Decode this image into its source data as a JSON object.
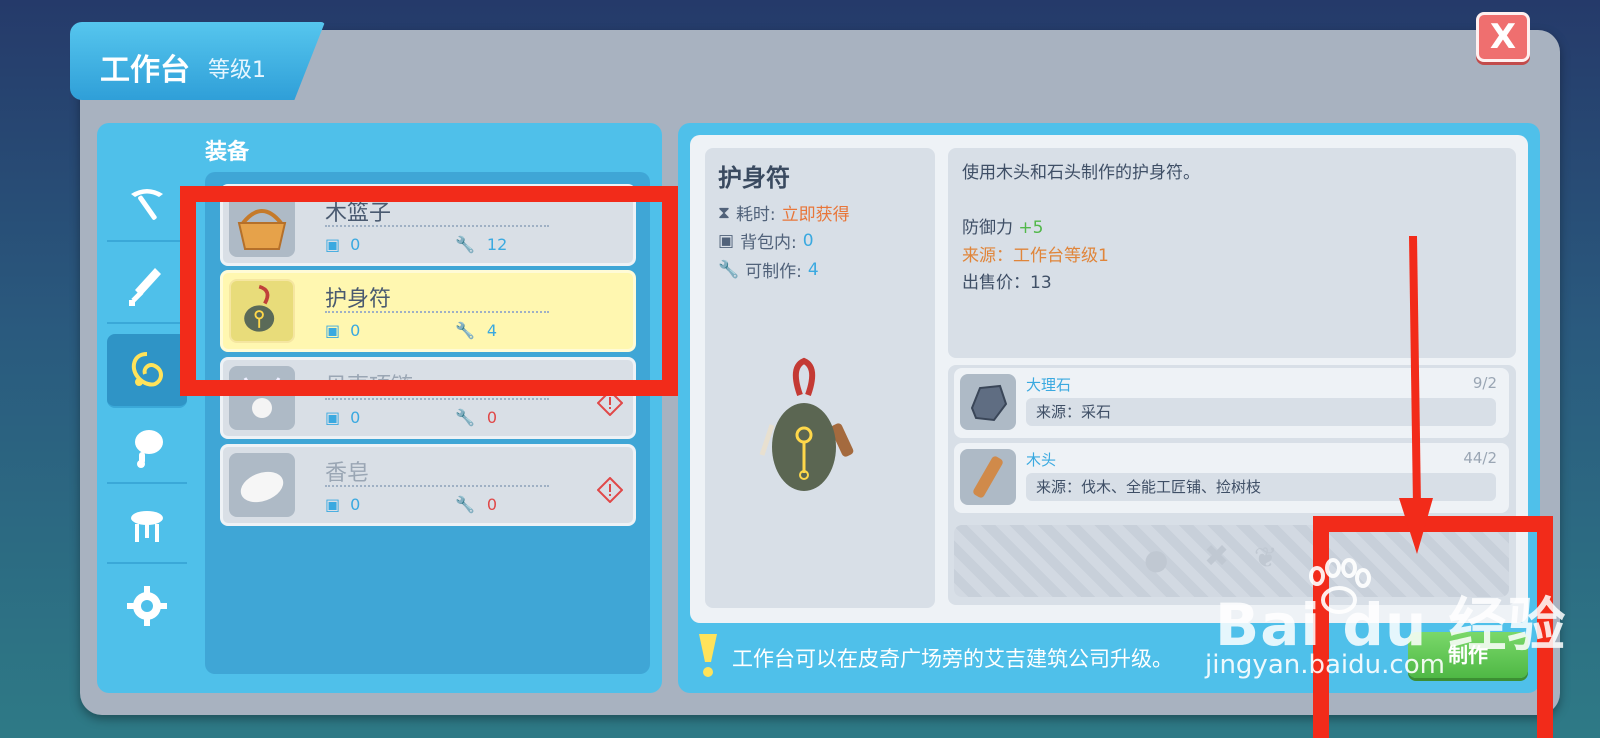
{
  "window": {
    "title": "工作台",
    "level": "等级1",
    "close_label": "X"
  },
  "category": {
    "title": "装备"
  },
  "sidebar": {
    "items": [
      {
        "icon": "pickaxe-icon"
      },
      {
        "icon": "sword-icon"
      },
      {
        "icon": "amulet-icon",
        "active": true
      },
      {
        "icon": "food-icon"
      },
      {
        "icon": "furniture-icon"
      },
      {
        "icon": "gear-icon"
      }
    ]
  },
  "recipes": [
    {
      "name": "木篮子",
      "bag": "0",
      "craftable": "12"
    },
    {
      "name": "护身符",
      "bag": "0",
      "craftable": "4"
    },
    {
      "name": "贝壳项链",
      "bag": "0",
      "craftable": "0"
    },
    {
      "name": "香皂",
      "bag": "0",
      "craftable": "0"
    }
  ],
  "detail": {
    "name": "护身符",
    "time_label": "耗时:",
    "time_value": "立即获得",
    "bag_label": "背包内:",
    "bag_value": "0",
    "craft_label": "可制作:",
    "craft_value": "4",
    "description": "使用木头和石头制作的护身符。",
    "defense_label": "防御力",
    "defense_value": "+5",
    "source_line": "来源：工作台等级1",
    "price_line": "出售价：13"
  },
  "materials": [
    {
      "name": "大理石",
      "count": "9/2",
      "source": "来源：采石"
    },
    {
      "name": "木头",
      "count": "44/2",
      "source": "来源：伐木、全能工匠铺、捡树枝"
    }
  ],
  "tip": "工作台可以在皮奇广场旁的艾吉建筑公司升级。",
  "craft_button": "制作",
  "watermark": {
    "logo": "Bai  du 经验",
    "url": "jingyan.baidu.com"
  },
  "colors": {
    "annotation_red": "#f22b1a",
    "panel_blue": "#4fc0ea",
    "highlight_yellow": "#fff7b0"
  }
}
